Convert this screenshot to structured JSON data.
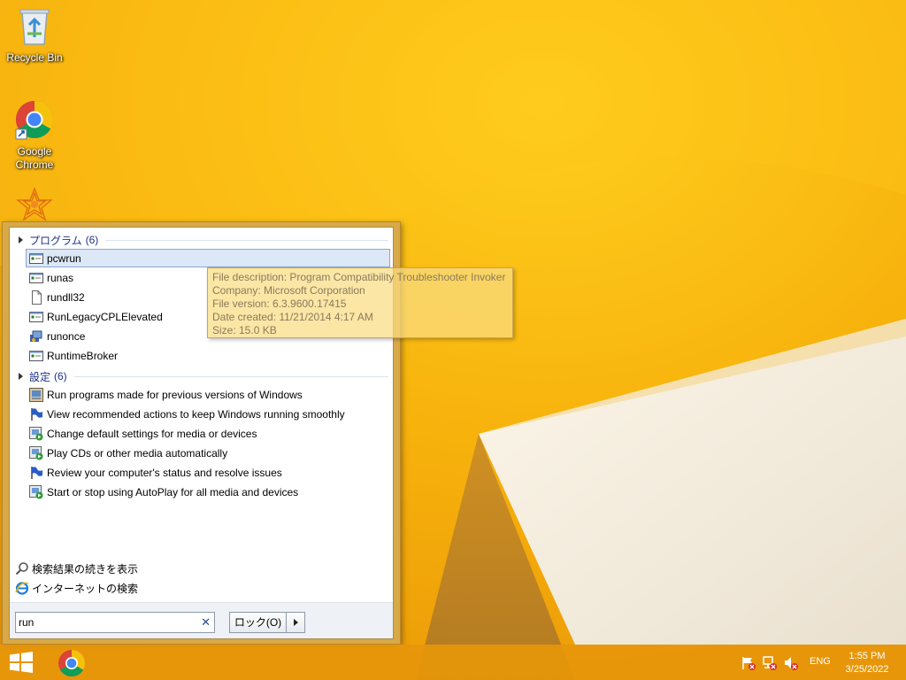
{
  "desktop": {
    "icons": [
      {
        "label": "Recycle Bin",
        "icon": "recycle-bin-icon"
      },
      {
        "label": "Google Chrome",
        "icon": "chrome-icon"
      },
      {
        "label": "",
        "icon": "app-starburst-icon"
      }
    ]
  },
  "start_menu": {
    "groups": [
      {
        "title": "プログラム",
        "count": "(6)",
        "items": [
          {
            "label": "pcwrun",
            "icon": "program-icon",
            "selected": true
          },
          {
            "label": "runas",
            "icon": "program-icon"
          },
          {
            "label": "rundll32",
            "icon": "file-icon"
          },
          {
            "label": "RunLegacyCPLElevated",
            "icon": "program-icon"
          },
          {
            "label": "runonce",
            "icon": "runonce-icon"
          },
          {
            "label": "RuntimeBroker",
            "icon": "program-icon"
          }
        ]
      },
      {
        "title": "設定",
        "count": "(6)",
        "items": [
          {
            "label": "Run programs made for previous versions of Windows",
            "icon": "compat-icon"
          },
          {
            "label": "View recommended actions to keep Windows running smoothly",
            "icon": "flag-icon"
          },
          {
            "label": "Change default settings for media or devices",
            "icon": "autoplay-icon"
          },
          {
            "label": "Play CDs or other media automatically",
            "icon": "autoplay-icon"
          },
          {
            "label": "Review your computer's status and resolve issues",
            "icon": "flag-icon"
          },
          {
            "label": "Start or stop using AutoPlay for all media and devices",
            "icon": "autoplay-icon"
          }
        ]
      }
    ],
    "more_results": "検索結果の続きを表示",
    "internet_search": "インターネットの検索",
    "search_value": "run",
    "lock_button": "ロック(O)"
  },
  "tooltip": {
    "lines": [
      "File description: Program Compatibility Troubleshooter Invoker",
      "Company: Microsoft Corporation",
      "File version: 6.3.9600.17415",
      "Date created: 11/21/2014 4:17 AM",
      "Size: 15.0 KB"
    ]
  },
  "taskbar": {
    "language": "ENG",
    "time": "1:55 PM",
    "date": "3/25/2022"
  },
  "colors": {
    "wallpaper": "#f3a80c",
    "taskbar": "#e6960a",
    "group_header": "#1e3287",
    "selected_bg": "#dce8f6"
  }
}
